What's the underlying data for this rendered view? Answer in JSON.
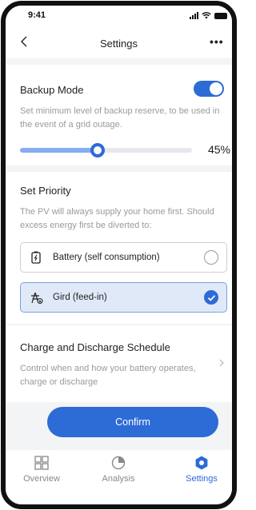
{
  "status_bar": {
    "time": "9:41"
  },
  "nav": {
    "title": "Settings",
    "more_label": "•••"
  },
  "backup": {
    "title": "Backup Mode",
    "enabled": true,
    "description": "Set minimum level of backup reserve, to be used in the event of a grid outage.",
    "reserve_percent": 45,
    "reserve_label": "45%"
  },
  "priority": {
    "title": "Set Priority",
    "description": "The PV will always supply your home first. Should excess energy first be diverted to:",
    "options": [
      {
        "label": "Battery (self consumption)",
        "selected": false,
        "icon": "battery-icon"
      },
      {
        "label": "Gird (feed-in)",
        "selected": true,
        "icon": "grid-icon"
      }
    ]
  },
  "schedule": {
    "title": "Charge and Discharge Schedule",
    "description": "Control when and how your battery operates, charge or discharge"
  },
  "confirm_label": "Confirm",
  "tabs": [
    {
      "label": "Overview",
      "icon": "grid-squares-icon",
      "active": false
    },
    {
      "label": "Analysis",
      "icon": "pie-chart-icon",
      "active": false
    },
    {
      "label": "Settings",
      "icon": "gear-icon",
      "active": true
    }
  ],
  "colors": {
    "accent": "#2d6bd6",
    "selected_bg": "#dfe9f8",
    "background": "#f3f4f6"
  }
}
